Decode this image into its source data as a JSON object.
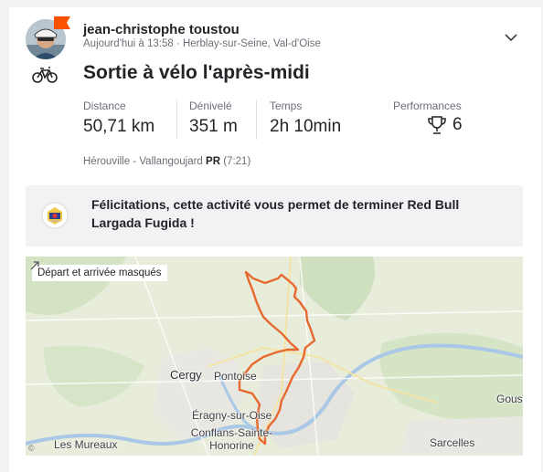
{
  "athlete": {
    "name": "jean-christophe toustou",
    "meta": "Aujourd'hui à 13:58 · Herblay-sur-Seine, Val-d'Oise"
  },
  "activity": {
    "title": "Sortie à vélo l'après-midi",
    "sport_icon": "bike-icon"
  },
  "stats": [
    {
      "label": "Distance",
      "value": "50,71 km"
    },
    {
      "label": "Dénivelé",
      "value": "351 m"
    },
    {
      "label": "Temps",
      "value": "2h 10min"
    }
  ],
  "performances": {
    "label": "Performances",
    "value": "6",
    "icon": "trophy-icon"
  },
  "segment": {
    "name": "Hérouville - Vallangoujard",
    "badge": "PR",
    "time": "(7:21)"
  },
  "challenge": {
    "text": "Félicitations, cette activité vous permet de terminer Red Bull Largada Fugida !",
    "logo_icon": "challenge-badge-icon"
  },
  "map": {
    "privacy_badge": "Départ et arrivée masqués",
    "copyright": "©",
    "places": [
      "Cergy",
      "Pontoise",
      "Éragny-sur-Oise",
      "Conflans-Sainte-Honorine",
      "Les Mureaux",
      "Sarcelles",
      "Gous"
    ],
    "route_color": "#e8692f"
  },
  "colors": {
    "accent": "#fc5200",
    "text": "#242428",
    "muted": "#6d6d78"
  }
}
